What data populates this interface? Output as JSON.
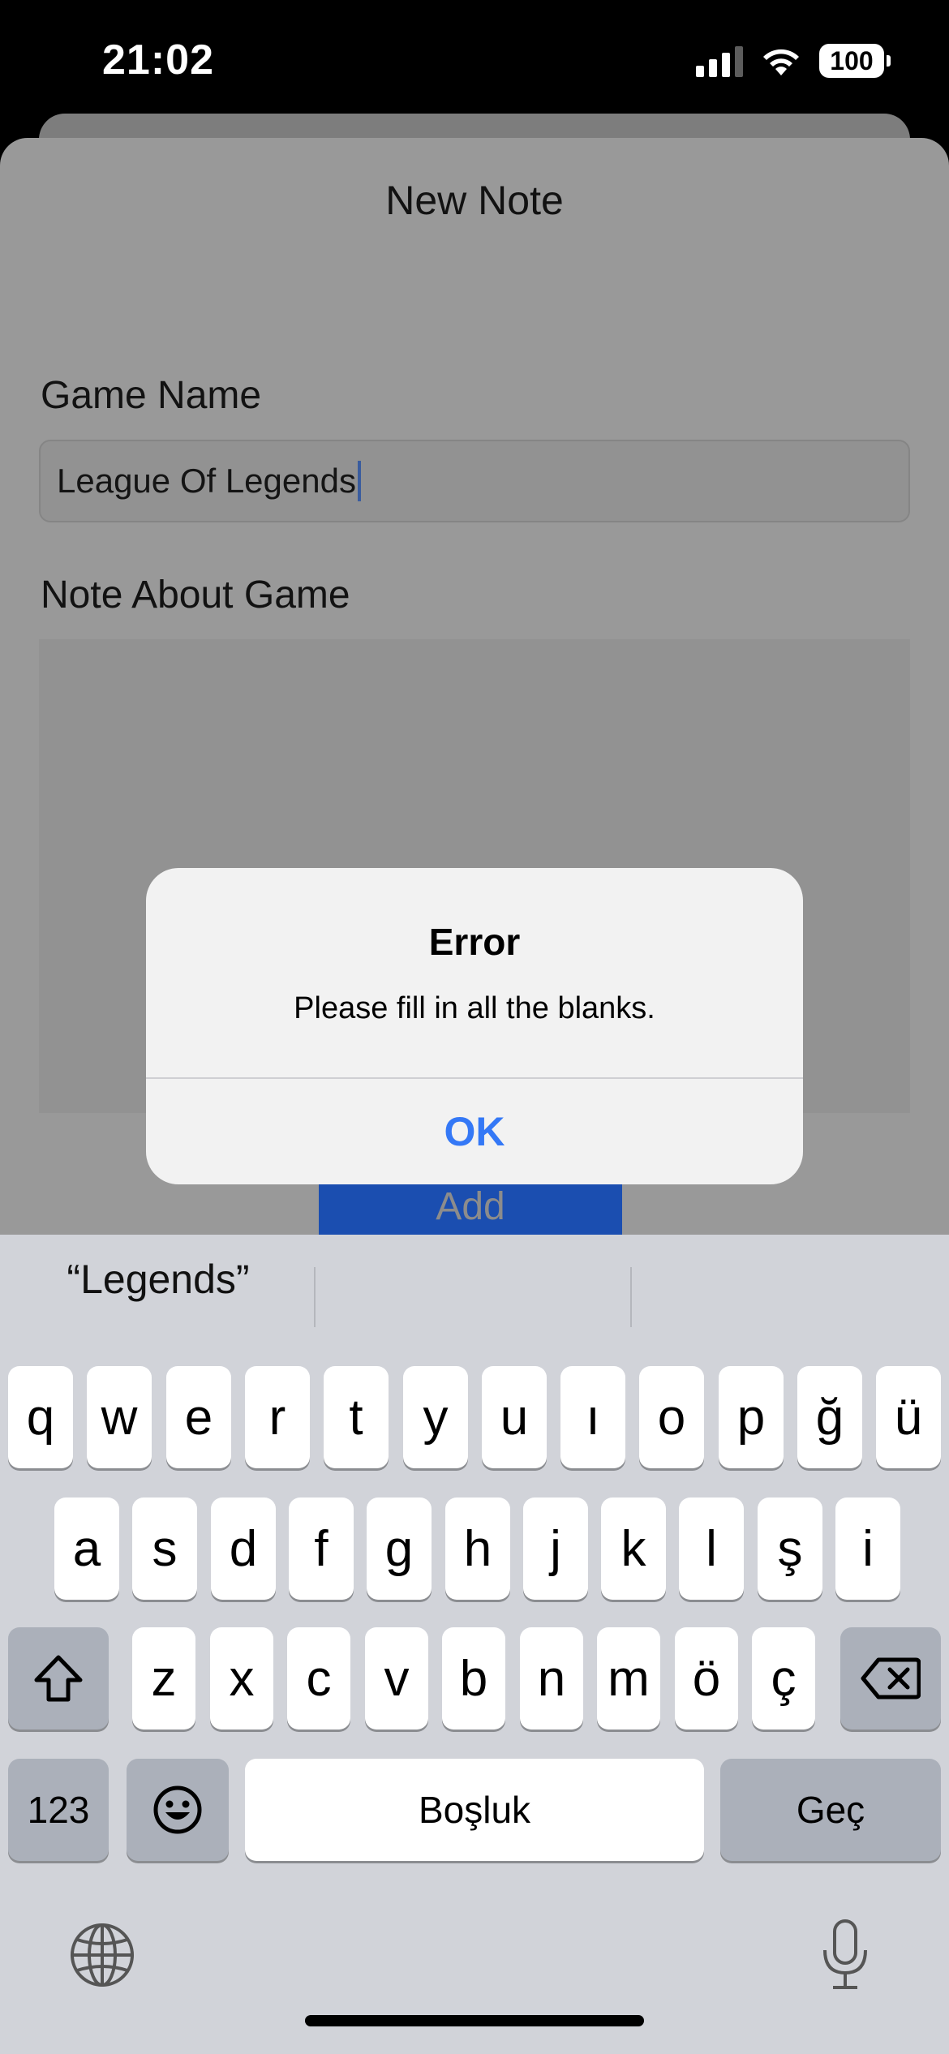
{
  "status_bar": {
    "time": "21:02",
    "battery": "100"
  },
  "sheet": {
    "title": "New Note",
    "game_name_label": "Game Name",
    "game_name_value": "League Of Legends",
    "note_label": "Note About Game",
    "note_value": "",
    "add_button_label": "Add",
    "add_button_color": "#1b4eb0"
  },
  "alert": {
    "title": "Error",
    "message": "Please fill in all the blanks.",
    "ok_label": "OK",
    "ok_color": "#3478f6"
  },
  "keyboard": {
    "suggestions": [
      "“Legends”",
      "",
      ""
    ],
    "row1": [
      "q",
      "w",
      "e",
      "r",
      "t",
      "y",
      "u",
      "ı",
      "o",
      "p",
      "ğ",
      "ü"
    ],
    "row2": [
      "a",
      "s",
      "d",
      "f",
      "g",
      "h",
      "j",
      "k",
      "l",
      "ş",
      "i"
    ],
    "row3": [
      "z",
      "x",
      "c",
      "v",
      "b",
      "n",
      "m",
      "ö",
      "ç"
    ],
    "numbers_label": "123",
    "space_label": "Boşluk",
    "return_label": "Geç",
    "icons": {
      "shift": "shift-icon",
      "backspace": "backspace-icon",
      "emoji": "emoji-icon",
      "globe": "globe-icon",
      "mic": "microphone-icon"
    }
  }
}
